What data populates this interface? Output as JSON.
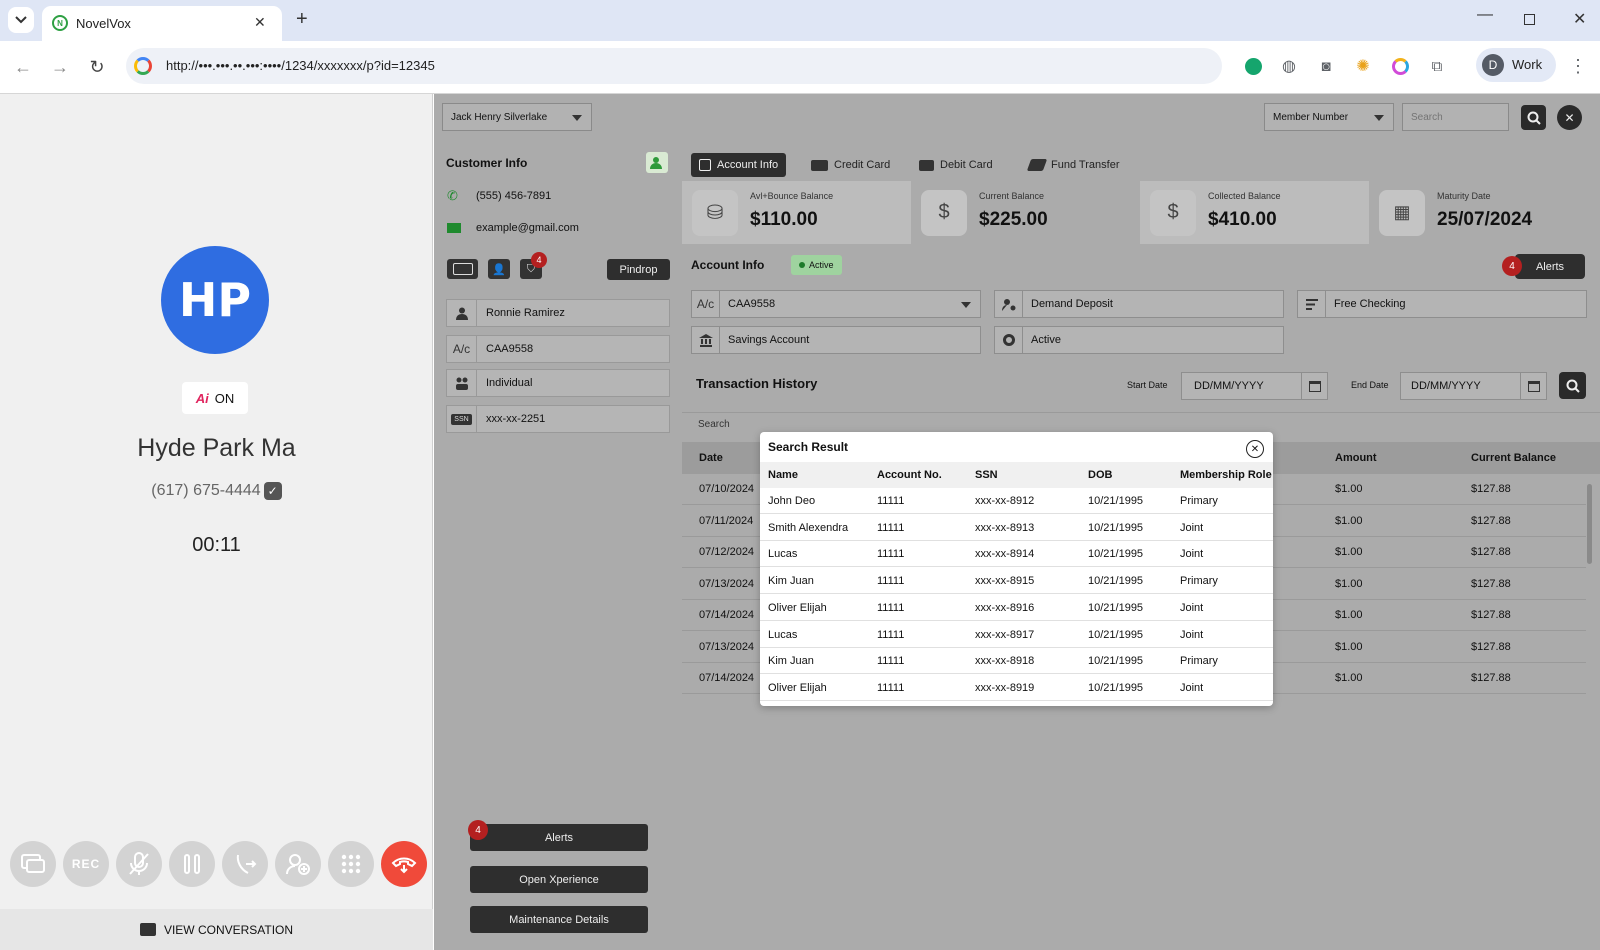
{
  "browser": {
    "tab_title": "NovelVox",
    "url": "http://•••.•••.••.•••:••••/1234/xxxxxxx/p?id=12345",
    "profile_initial": "D",
    "profile_label": "Work"
  },
  "call": {
    "initials": "HP",
    "ai_label": "ON",
    "caller_name": "Hyde Park Ma",
    "phone": "(617) 675-4444",
    "timer": "00:11",
    "rec_label": "REC",
    "view_conversation": "VIEW CONVERSATION"
  },
  "customer": {
    "title": "Customer Info",
    "phone": "(555) 456-7891",
    "email": "example@gmail.com",
    "shield_badge": "4",
    "pindrop_label": "Pindrop",
    "name": "Ronnie Ramirez",
    "account_prefix": "A/c",
    "account": "CAA9558",
    "type": "Individual",
    "ssn_tag": "SSN",
    "ssn": "xxx-xx-2251",
    "alerts_label": "Alerts",
    "alerts_count": "4",
    "open_xperience": "Open Xperience",
    "maintenance": "Maintenance Details"
  },
  "top": {
    "core_system": "Jack Henry Silverlake",
    "search_by": "Member Number",
    "search_placeholder": "Search"
  },
  "tabs": [
    "Account Info",
    "Credit Card",
    "Debit Card",
    "Fund Transfer"
  ],
  "balances": [
    {
      "label": "Avl+Bounce Balance",
      "value": "$110.00"
    },
    {
      "label": "Current Balance",
      "value": "$225.00"
    },
    {
      "label": "Collected Balance",
      "value": "$410.00"
    },
    {
      "label": "Maturity Date",
      "value": "25/07/2024"
    }
  ],
  "account_info": {
    "title": "Account Info",
    "status_chip": "Active",
    "alerts_label": "Alerts",
    "alerts_count": "4",
    "ac_prefix": "A/c",
    "account_number": "CAA9558",
    "product": "Demand Deposit",
    "plan": "Free Checking",
    "account_type": "Savings Account",
    "status": "Active"
  },
  "transactions": {
    "title": "Transaction History",
    "start_label": "Start Date",
    "end_label": "End Date",
    "date_placeholder": "DD/MM/YYYY",
    "search_label": "Search",
    "headers": {
      "date": "Date",
      "amount": "Amount",
      "balance": "Current Balance"
    },
    "rows": [
      {
        "date": "07/10/2024",
        "amount": "$1.00",
        "balance": "$127.88"
      },
      {
        "date": "07/11/2024",
        "amount": "$1.00",
        "balance": "$127.88"
      },
      {
        "date": "07/12/2024",
        "amount": "$1.00",
        "balance": "$127.88"
      },
      {
        "date": "07/13/2024",
        "amount": "$1.00",
        "balance": "$127.88"
      },
      {
        "date": "07/14/2024",
        "amount": "$1.00",
        "balance": "$127.88"
      },
      {
        "date": "07/13/2024",
        "amount": "$1.00",
        "balance": "$127.88"
      },
      {
        "date": "07/14/2024",
        "amount": "$1.00",
        "balance": "$127.88"
      }
    ]
  },
  "search_result": {
    "title": "Search Result",
    "headers": [
      "Name",
      "Account No.",
      "SSN",
      "DOB",
      "Membership Role"
    ],
    "rows": [
      [
        "John Deo",
        "11111",
        "xxx-xx-8912",
        "10/21/1995",
        "Primary"
      ],
      [
        "Smith Alexendra",
        "11111",
        "xxx-xx-8913",
        "10/21/1995",
        "Joint"
      ],
      [
        "Lucas",
        "11111",
        "xxx-xx-8914",
        "10/21/1995",
        "Joint"
      ],
      [
        "Kim Juan",
        "11111",
        "xxx-xx-8915",
        "10/21/1995",
        "Primary"
      ],
      [
        "Oliver Elijah",
        "11111",
        "xxx-xx-8916",
        "10/21/1995",
        "Joint"
      ],
      [
        "Lucas",
        "11111",
        "xxx-xx-8917",
        "10/21/1995",
        "Joint"
      ],
      [
        "Kim Juan",
        "11111",
        "xxx-xx-8918",
        "10/21/1995",
        "Primary"
      ],
      [
        "Oliver Elijah",
        "11111",
        "xxx-xx-8919",
        "10/21/1995",
        "Joint"
      ]
    ]
  }
}
